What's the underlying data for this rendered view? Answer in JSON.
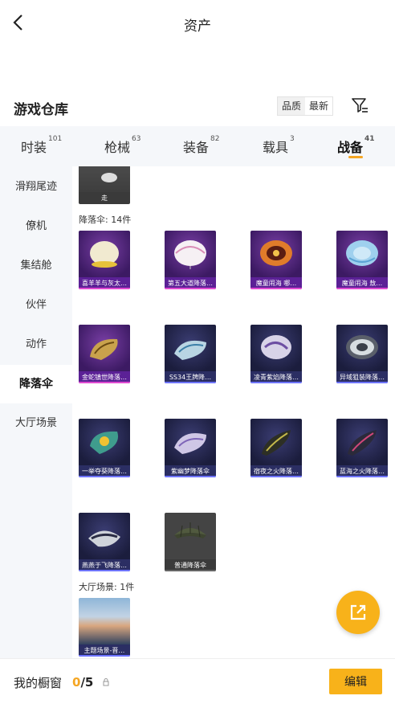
{
  "header": {
    "title": "资产"
  },
  "warehouse": {
    "title": "游戏仓库",
    "sort": [
      "品质",
      "最新"
    ]
  },
  "tabs": [
    {
      "label": "时装",
      "count": "101"
    },
    {
      "label": "枪械",
      "count": "63"
    },
    {
      "label": "装备",
      "count": "82"
    },
    {
      "label": "载具",
      "count": "3"
    },
    {
      "label": "战备",
      "count": "41"
    }
  ],
  "sidebar": [
    "滑翔尾迹",
    "僚机",
    "集结舱",
    "伙伴",
    "动作",
    "降落伞",
    "大厅场景"
  ],
  "partial_item": {
    "label": "走"
  },
  "sections": {
    "parachute": "降落伞: 14件",
    "lobby": "大厅场景: 1件"
  },
  "parachutes": [
    {
      "label": "喜羊羊与灰太…"
    },
    {
      "label": "第五大道降落…"
    },
    {
      "label": "魔童闹海 哪…"
    },
    {
      "label": "魔童闹海 敖…"
    },
    {
      "label": "金蛇镇世降落…"
    },
    {
      "label": "SS34王牌降…"
    },
    {
      "label": "凌青紫焰降落…"
    },
    {
      "label": "异域狙装降落…"
    },
    {
      "label": "一举夺葵降落…"
    },
    {
      "label": "紫幽梦降落伞"
    },
    {
      "label": "宿夜之火降落…"
    },
    {
      "label": "蓝海之火降落…"
    },
    {
      "label": "燕燕于飞降落…"
    },
    {
      "label": "普通降落伞"
    }
  ],
  "scenes": [
    {
      "label": "主题场景-晋…"
    }
  ],
  "showcase": {
    "label": "我的橱窗",
    "current": "0",
    "total": "5"
  },
  "edit_button": "编辑",
  "colors": {
    "accent": "#f8b21a"
  }
}
